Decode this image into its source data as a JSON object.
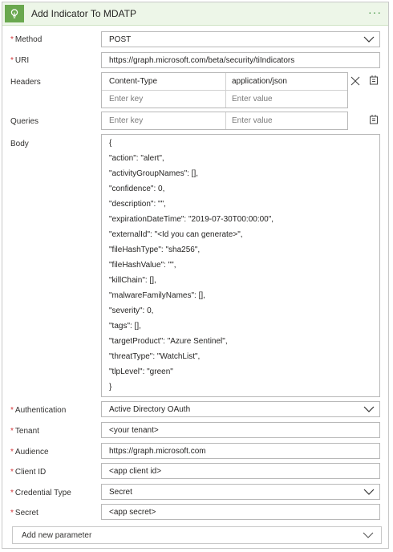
{
  "header": {
    "title": "Add Indicator To MDATP",
    "more_label": "···",
    "icon": "bulb-icon"
  },
  "fields": {
    "method": {
      "label": "Method",
      "required": true,
      "value": "POST"
    },
    "uri": {
      "label": "URI",
      "required": true,
      "value": "https://graph.microsoft.com/beta/security/tiIndicators"
    },
    "headers": {
      "label": "Headers",
      "rows": [
        {
          "key": "Content-Type",
          "value": "application/json"
        }
      ],
      "key_placeholder": "Enter key",
      "value_placeholder": "Enter value"
    },
    "queries": {
      "label": "Queries",
      "key_placeholder": "Enter key",
      "value_placeholder": "Enter value"
    },
    "body": {
      "label": "Body",
      "lines": [
        "{",
        "  \"action\": \"alert\",",
        "  \"activityGroupNames\": [],",
        "  \"confidence\": 0,",
        "  \"description\": \"\",",
        "  \"expirationDateTime\": \"2019-07-30T00:00:00\",",
        "  \"externalId\": \"<Id you can generate>\",",
        "  \"fileHashType\": \"sha256\",",
        "  \"fileHashValue\": \"\",",
        "  \"killChain\": [],",
        "  \"malwareFamilyNames\": [],",
        "  \"severity\": 0,",
        "  \"tags\": [],",
        "  \"targetProduct\": \"Azure Sentinel\",",
        "  \"threatType\": \"WatchList\",",
        "  \"tlpLevel\": \"green\"",
        "}"
      ]
    },
    "authentication": {
      "label": "Authentication",
      "required": true,
      "value": "Active Directory OAuth"
    },
    "tenant": {
      "label": "Tenant",
      "required": true,
      "value": "<your tenant>"
    },
    "audience": {
      "label": "Audience",
      "required": true,
      "value": "https://graph.microsoft.com"
    },
    "client_id": {
      "label": "Client ID",
      "required": true,
      "value": "<app client id>"
    },
    "credential_type": {
      "label": "Credential Type",
      "required": true,
      "value": "Secret"
    },
    "secret": {
      "label": "Secret",
      "required": true,
      "value": "<app secret>"
    }
  },
  "add_parameter": {
    "label": "Add new parameter"
  },
  "required_marker": "*",
  "colors": {
    "header_bg": "#edf6e8",
    "icon_bg": "#6aa84f",
    "required": "#d13438",
    "border": "#b8b8b8"
  }
}
